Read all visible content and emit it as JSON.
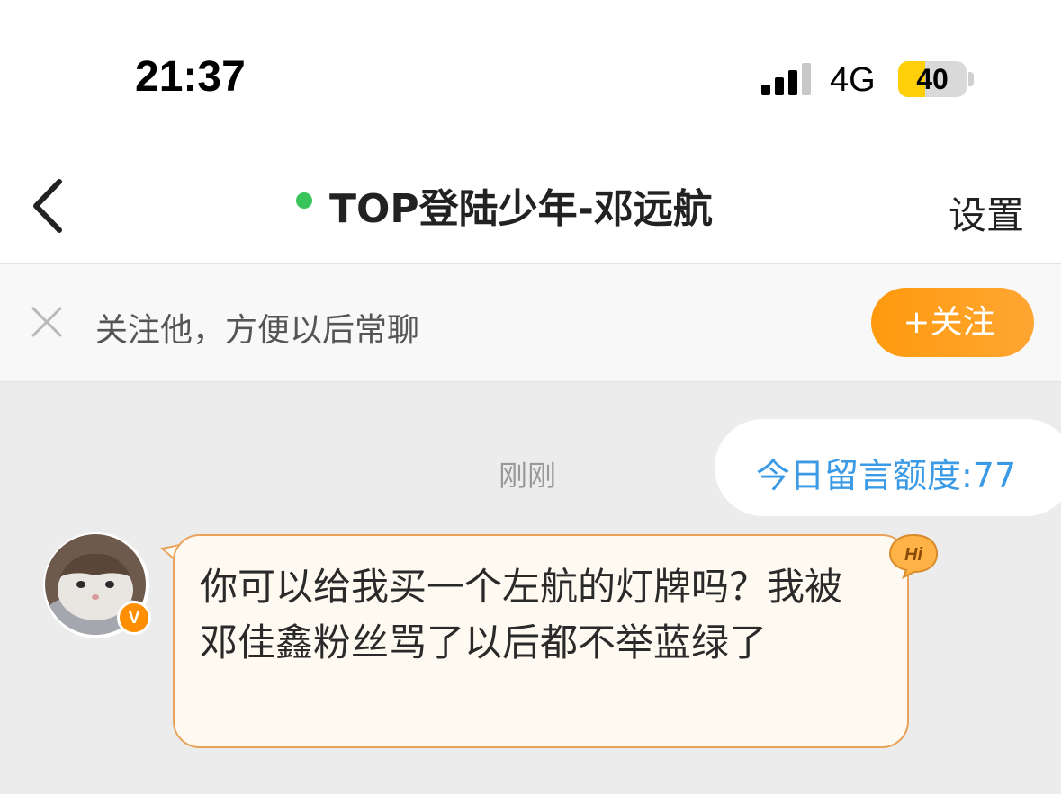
{
  "status_bar": {
    "time": "21:37",
    "network": "4G",
    "battery_level": "40",
    "battery_fraction": 0.4
  },
  "nav": {
    "title": "TOP登陆少年-邓远航",
    "online": true,
    "settings_label": "设置"
  },
  "follow_banner": {
    "hint": "关注他，方便以后常聊",
    "button_label": "+关注"
  },
  "chat": {
    "timestamp": "刚刚",
    "quota_text": "今日留言额度:77",
    "message": {
      "text": "你可以给我买一个左航的灯牌吗？我被邓佳鑫粉丝骂了以后都不举蓝绿了",
      "verified_badge": "V",
      "sticker": "Hi"
    }
  },
  "colors": {
    "online_dot": "#39c35b",
    "follow_button": "#ff9a0e",
    "quota_text": "#3b9ae5",
    "bubble_border": "#e9a25a",
    "bubble_fill": "#fffaf1",
    "battery_fill": "#ffcf0a"
  }
}
